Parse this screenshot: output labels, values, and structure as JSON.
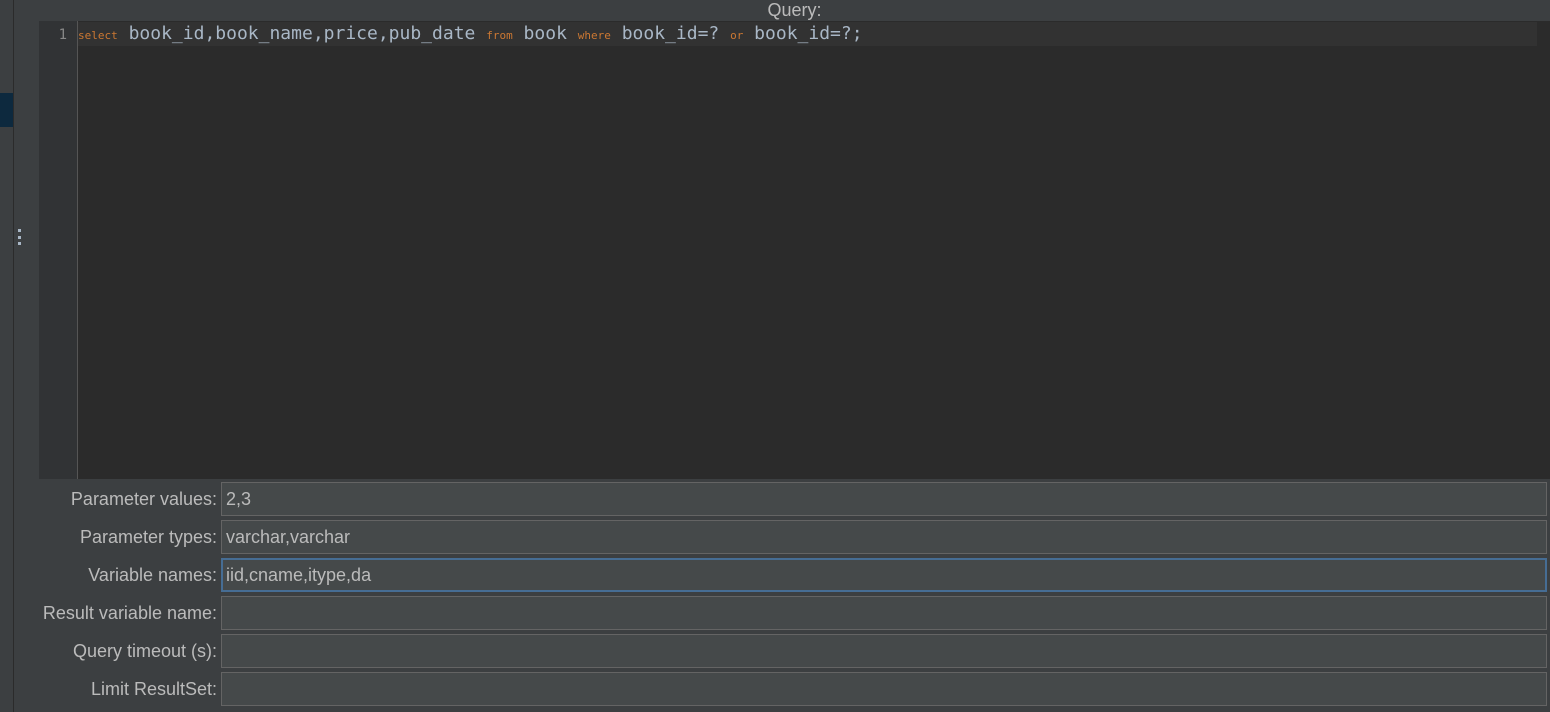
{
  "query": {
    "title": "Query:",
    "line_number": "1",
    "tokens": [
      {
        "text": "select",
        "kind": "keyword"
      },
      {
        "text": " book_id,book_name,price,pub_date ",
        "kind": "text"
      },
      {
        "text": "from",
        "kind": "keyword"
      },
      {
        "text": " book ",
        "kind": "text"
      },
      {
        "text": "where",
        "kind": "keyword"
      },
      {
        "text": " book_id=? ",
        "kind": "text"
      },
      {
        "text": "or",
        "kind": "keyword"
      },
      {
        "text": " book_id=?;",
        "kind": "text"
      }
    ]
  },
  "form": {
    "parameter_values": {
      "label": "Parameter values:",
      "value": "2,3"
    },
    "parameter_types": {
      "label": "Parameter types:",
      "value": "varchar,varchar"
    },
    "variable_names": {
      "label": "Variable names:",
      "value": "iid,cname,itype,da"
    },
    "result_variable_name": {
      "label": "Result variable name:",
      "value": ""
    },
    "query_timeout": {
      "label": "Query timeout (s):",
      "value": ""
    },
    "limit_resultset": {
      "label": "Limit ResultSet:",
      "value": ""
    }
  },
  "colors": {
    "background": "#3c3f41",
    "editor_background": "#2b2b2b",
    "keyword": "#cc7832",
    "code_text": "#a9b7c6",
    "focus_border": "#466d94"
  },
  "icons": {
    "splitter": "vertical-dots-icon"
  }
}
